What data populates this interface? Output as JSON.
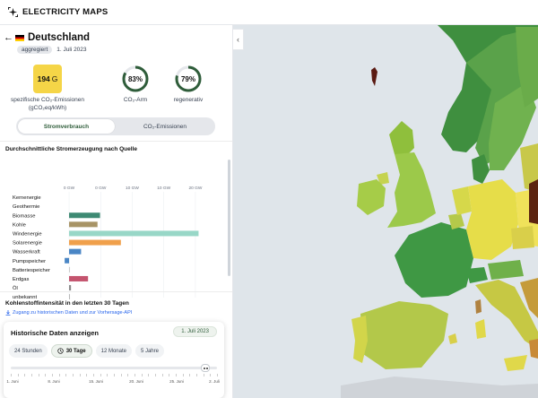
{
  "app": {
    "title": "ELECTRICITY MAPS"
  },
  "zone": {
    "name": "Deutschland",
    "badge": "aggregiert",
    "date": "1. Juli 2023"
  },
  "metrics": {
    "co2_value": "194",
    "co2_unit": "G",
    "co2_label_line1": "spezifische CO₂-Emissionen",
    "co2_label_line2": "(gCO₂eq/kWh)",
    "low_carbon_pct": "83%",
    "low_carbon_fraction": 0.83,
    "low_carbon_label": "CO₂-Arm",
    "renewable_pct": "79%",
    "renewable_fraction": 0.79,
    "renewable_label": "regenerativ"
  },
  "toggle": {
    "option1": "Stromverbrauch",
    "option2": "CO₂-Emissionen",
    "active": "Stromverbrauch"
  },
  "production": {
    "title": "Durchschnittliche Stromerzeugung nach Quelle"
  },
  "chart_data": {
    "type": "bar",
    "orientation": "horizontal",
    "title": "Durchschnittliche Stromerzeugung nach Quelle",
    "x_ticks": [
      "0 GW",
      "0 GW",
      "10 GW",
      "10 GW",
      "20 GW"
    ],
    "xlim": [
      -1,
      22
    ],
    "categories": [
      "Kernenergie",
      "Geothermie",
      "Biomasse",
      "Kohle",
      "Windenergie",
      "Solarenergie",
      "Wasserkraft",
      "Pumpspeicher",
      "Batteriespeicher",
      "Erdgas",
      "Öl",
      "unbekannt"
    ],
    "values": [
      0,
      0,
      4.9,
      4.5,
      20.5,
      8.2,
      1.9,
      -0.7,
      0.1,
      3.0,
      0.3,
      0.1
    ],
    "colors": [
      "#9b6fc2",
      "#b05d3b",
      "#3e8a73",
      "#a89466",
      "#98d7c7",
      "#f0a04b",
      "#4a86c5",
      "#4a86c5",
      "#c9c9c9",
      "#c4546e",
      "#8a8a8a",
      "#b5b5b5"
    ]
  },
  "history": {
    "section_title": "Kohlenstoffintensität in den letzten 30 Tagen",
    "link": "Zugang zu historischen Daten und zur Vorhersage-API",
    "card_title": "Historische Daten anzeigen",
    "selected_date": "1. Juli 2023",
    "options": [
      "24 Stunden",
      "30 Tage",
      "12 Monate",
      "5 Jahre"
    ],
    "active_option": "30 Tage",
    "slider_labels": [
      "1. Juni",
      "8. Juni",
      "15. Juni",
      "20. Juni",
      "25. Juni",
      "2. Juli"
    ]
  },
  "colors": {
    "accent_green": "#2f5d3a",
    "co2_yellow": "#f5d547"
  }
}
